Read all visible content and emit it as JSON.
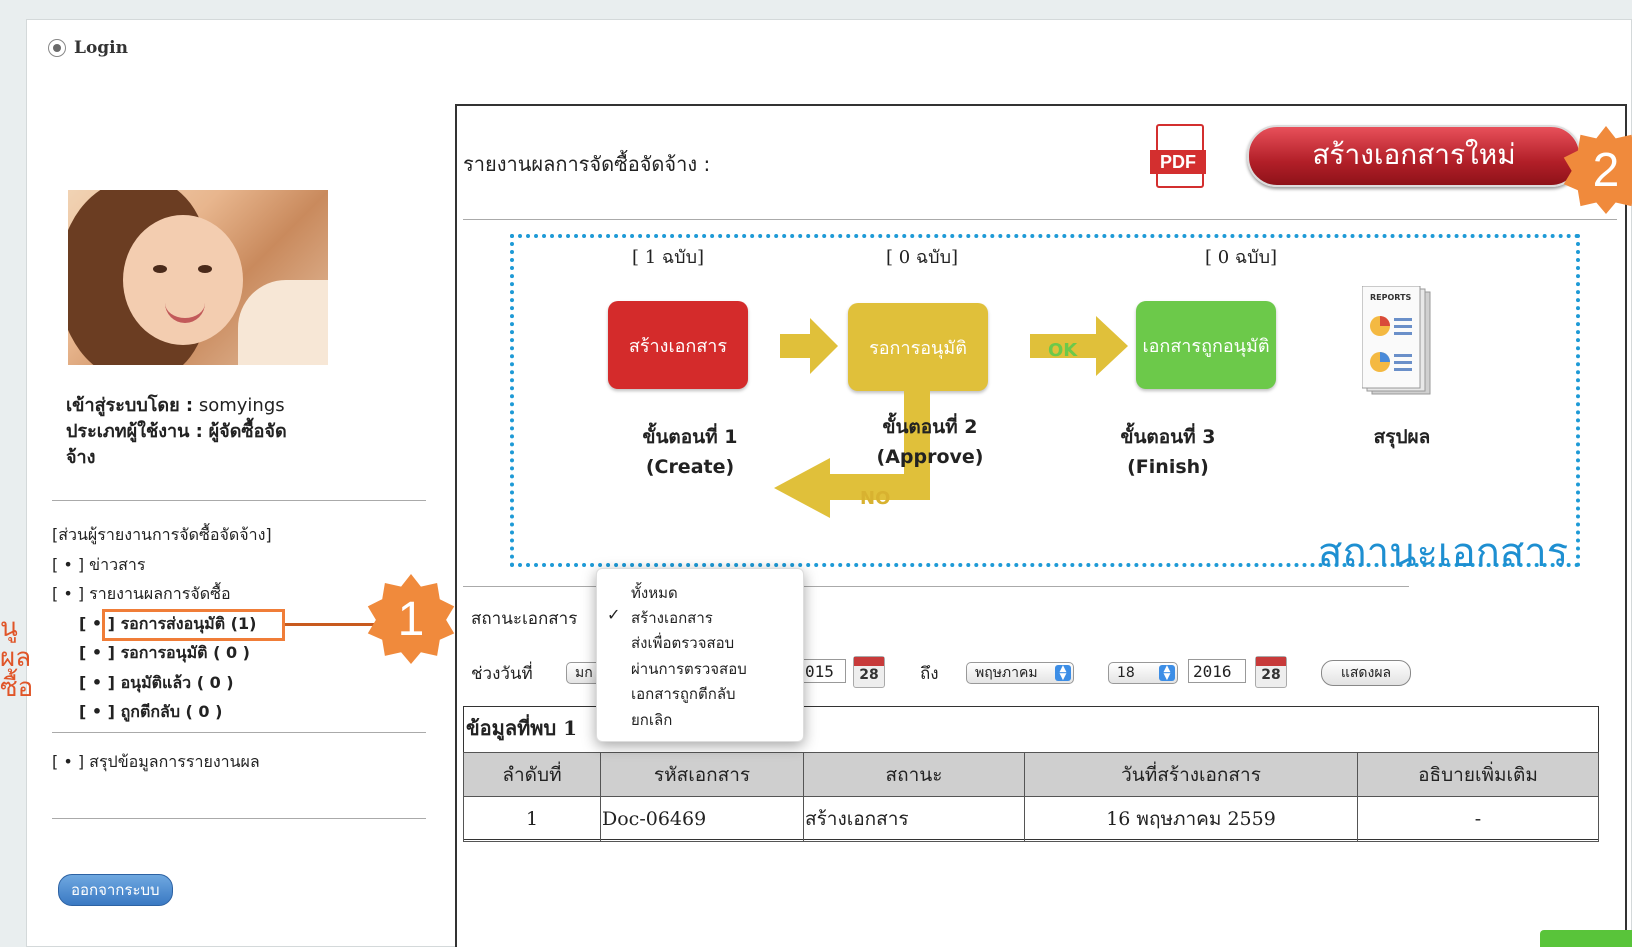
{
  "login": {
    "label": "Login"
  },
  "user": {
    "login_label": "เข้าสู่ระบบโดย :",
    "username": "somyings",
    "type_label": "ประเภทผู้ใช้งาน :",
    "type_value": "ผู้จัดซื้อจัด",
    "type_value_cont": "จ้าง"
  },
  "menu": {
    "section": "[ส่วนผู้รายงานการจัดซื้อจัดจ้าง]",
    "news": "[ • ] ข่าวสาร",
    "report": "[ • ] รายงานผลการจัดซื้อ",
    "pending_send": "[ • ] รอการส่งอนุมัติ (1)",
    "pending_approve": "[ • ] รอการอนุมัติ ( 0 )",
    "approved": "[ • ] อนุมัติแล้ว ( 0 )",
    "rejected": "[ • ] ถูกตีกลับ ( 0 )",
    "summary": "[ • ] สรุปข้อมูลการรายงานผล"
  },
  "logout_label": "ออกจากระบบ",
  "callouts": {
    "one": "1",
    "two": "2",
    "cut_lines": [
      "นู",
      "ผล",
      "ซื้อ"
    ]
  },
  "main": {
    "title": "รายงานผลการจัดซื้อจัดจ้าง :",
    "pdf_label": "PDF",
    "new_doc_button": "สร้างเอกสารใหม่",
    "status_caption": "สถานะเอกสาร"
  },
  "workflow": {
    "steps": [
      {
        "count": "[ 1 ฉบับ]",
        "box": "สร้างเอกสาร",
        "label": "ขั้นตอนที่ 1",
        "sub": "(Create)",
        "color": "#d42b2b"
      },
      {
        "count": "[ 0 ฉบับ]",
        "box": "รอการอนุมัติ",
        "label": "ขั้นตอนที่ 2",
        "sub": "(Approve)",
        "color": "#e0c03a"
      },
      {
        "count": "[ 0 ฉบับ]",
        "box": "เอกสารถูกอนุมัติ",
        "label": "ขั้นตอนที่ 3",
        "sub": "(Finish)",
        "color": "#6cc94a"
      }
    ],
    "summary_label": "สรุปผล",
    "ok": "OK",
    "no": "NO",
    "report_icon_text": "REPORTS"
  },
  "filter": {
    "status_label": "สถานะเอกสาร",
    "status_options": [
      "ทั้งหมด",
      "สร้างเอกสาร",
      "ส่งเพื่อตรวจสอบ",
      "ผ่านการตรวจสอบ",
      "เอกสารถูกตีกลับ",
      "ยกเลิก"
    ],
    "status_selected": "สร้างเอกสาร",
    "check": "✓",
    "date_label": "ช่วงวันที่",
    "from_month": "มก",
    "from_year": "015",
    "to_label": "ถึง",
    "to_month": "พฤษภาคม",
    "to_day": "18",
    "to_year": "2016",
    "cal_day": "28",
    "show_button": "แสดงผล"
  },
  "results": {
    "found_label": "ข้อมูลที่พบ 1",
    "columns": [
      "ลำดับที่",
      "รหัสเอกสาร",
      "สถานะ",
      "วันที่สร้างเอกสาร",
      "อธิบายเพิ่มเติม"
    ],
    "rows": [
      [
        "1",
        "Doc-06469",
        "สร้างเอกสาร",
        "16 พฤษภาคม 2559",
        "-"
      ]
    ]
  }
}
